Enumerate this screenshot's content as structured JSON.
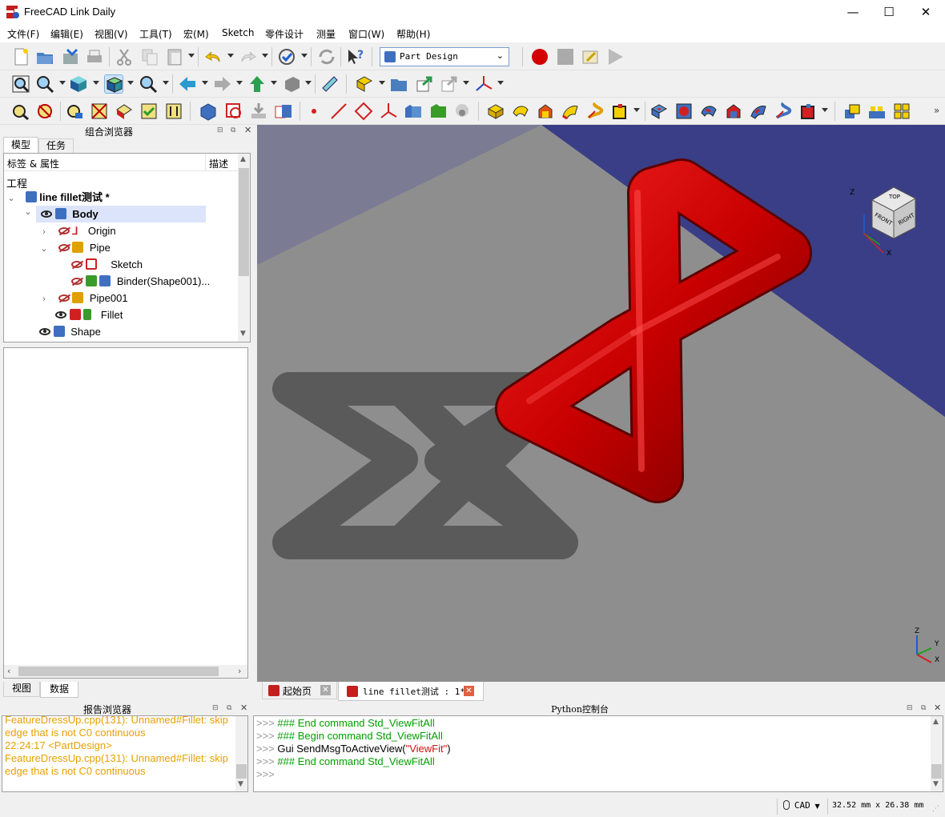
{
  "window": {
    "title": "FreeCAD Link Daily",
    "minimize": "—",
    "maximize": "☐",
    "close": "✕"
  },
  "menu": [
    "文件(F)",
    "编辑(E)",
    "视图(V)",
    "工具(T)",
    "宏(M)",
    "Sketch",
    "零件设计",
    "测量",
    "窗口(W)",
    "帮助(H)"
  ],
  "toolbar": {
    "workbench": "Part Design",
    "overflow": "»"
  },
  "combo_view": {
    "title": "组合浏览器",
    "tabs": [
      "模型",
      "任务"
    ],
    "header_label": "标签 & 属性",
    "header_desc": "描述",
    "section": "工程",
    "tree": [
      {
        "label": "line fillet测试 *"
      },
      {
        "label": "Body"
      },
      {
        "label": "Origin"
      },
      {
        "label": "Pipe"
      },
      {
        "label": "Sketch"
      },
      {
        "label": "Binder(Shape001)..."
      },
      {
        "label": "Pipe001"
      },
      {
        "label": "Fillet"
      },
      {
        "label": "Shape"
      }
    ],
    "bottom_tabs": [
      "视图",
      "数据"
    ]
  },
  "report_view": {
    "title": "报告浏览器",
    "lines": [
      "FeatureDressUp.cpp(131): Unnamed#Fillet: skip",
      "edge  that is not C0 continuous",
      "22:24:17  <PartDesign>",
      "FeatureDressUp.cpp(131): Unnamed#Fillet: skip",
      "edge  that is not C0 continuous"
    ],
    "color": "#e8a000"
  },
  "python_console": {
    "title": "Python控制台",
    "prompt": ">>>",
    "lines": [
      {
        "text": "### End command Std_ViewFitAll",
        "kind": "comment"
      },
      {
        "text": "### Begin command Std_ViewFitAll",
        "kind": "comment"
      },
      {
        "pre": "Gui SendMsgToActiveView(",
        "str": "\"ViewFit\"",
        "post": ")",
        "kind": "code"
      },
      {
        "text": "### End command Std_ViewFitAll",
        "kind": "comment"
      },
      {
        "text": "",
        "kind": "empty"
      }
    ]
  },
  "document_tabs": [
    {
      "label": "起始页"
    },
    {
      "label": "line fillet测试 : 1*"
    }
  ],
  "navcube": {
    "top": "TOP",
    "front": "FRONT",
    "right": "RIGHT",
    "axis_x": "X",
    "axis_y": "Y",
    "axis_z": "Z"
  },
  "status_bar": {
    "nav_style": "CAD",
    "dimensions": "32.52 mm x 26.38 mm"
  },
  "colors": {
    "viewport_top": "#3a3e86",
    "ground": "#8e8e8e",
    "pipe": "#cc0000",
    "shadow": "#5a5a5a",
    "comment_green": "#00a000",
    "string_red": "#d01010"
  }
}
